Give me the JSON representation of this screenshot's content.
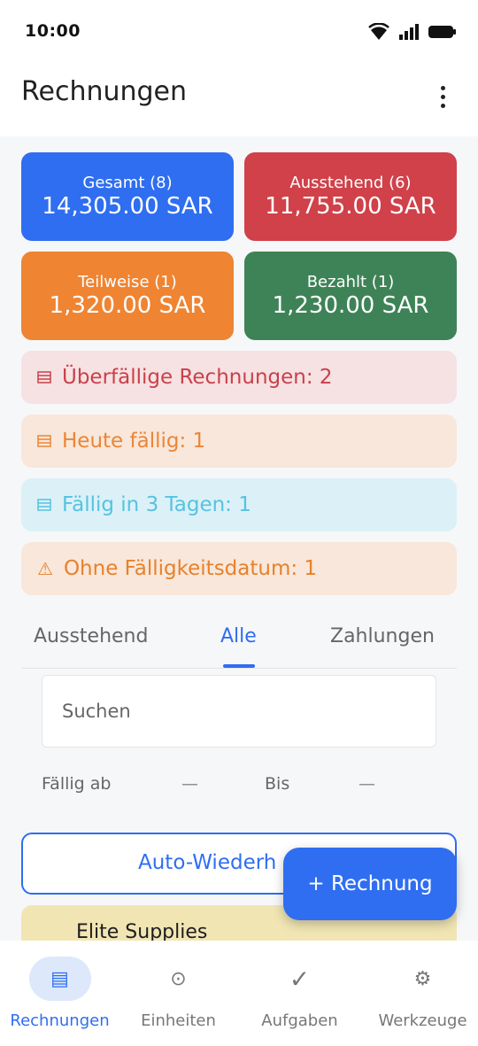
{
  "status_bar": {
    "time": "10:00"
  },
  "app_bar": {
    "title": "Rechnungen"
  },
  "summary_cards": [
    {
      "label": "Gesamt (8)",
      "value": "14,305.00 SAR",
      "color": "#2f6ef0"
    },
    {
      "label": "Ausstehend (6)",
      "value": "11,755.00 SAR",
      "color": "#d0414a"
    },
    {
      "label": "Teilweise (1)",
      "value": "1,320.00 SAR",
      "color": "#ef8432"
    },
    {
      "label": "Bezahlt (1)",
      "value": "1,230.00 SAR",
      "color": "#3e8357"
    }
  ],
  "alerts": [
    {
      "icon": "list-icon",
      "text": "Überfällige Rechnungen: 2"
    },
    {
      "icon": "list-icon",
      "text": "Heute fällig: 1"
    },
    {
      "icon": "list-icon",
      "text": "Fällig in 3 Tagen: 1"
    },
    {
      "icon": "warning-icon",
      "icon_glyph": "⚠",
      "text": "Ohne Fälligkeitsdatum: 1"
    }
  ],
  "tabs": [
    {
      "label": "Ausstehend",
      "selected": false
    },
    {
      "label": "Alle",
      "selected": true
    },
    {
      "label": "Zahlungen",
      "selected": false
    }
  ],
  "search": {
    "placeholder": "Suchen",
    "value": ""
  },
  "filters": {
    "due_from_label": "Fällig ab",
    "due_from_value": "—",
    "to_label": "Bis",
    "to_value": "—"
  },
  "auto_button": {
    "label": "Auto-Wiederh"
  },
  "invoice_list": [
    {
      "name": "Elite Supplies"
    }
  ],
  "fab": {
    "label": "+ Rechnung"
  },
  "bottom_nav": [
    {
      "label": "Rechnungen",
      "icon": "invoice-icon",
      "glyph": "▤",
      "active": true
    },
    {
      "label": "Einheiten",
      "icon": "units-icon",
      "glyph": "⊙",
      "active": false
    },
    {
      "label": "Aufgaben",
      "icon": "check-icon",
      "glyph": "✓",
      "active": false
    },
    {
      "label": "Werkzeuge",
      "icon": "tools-icon",
      "glyph": "⚙",
      "active": false
    }
  ]
}
